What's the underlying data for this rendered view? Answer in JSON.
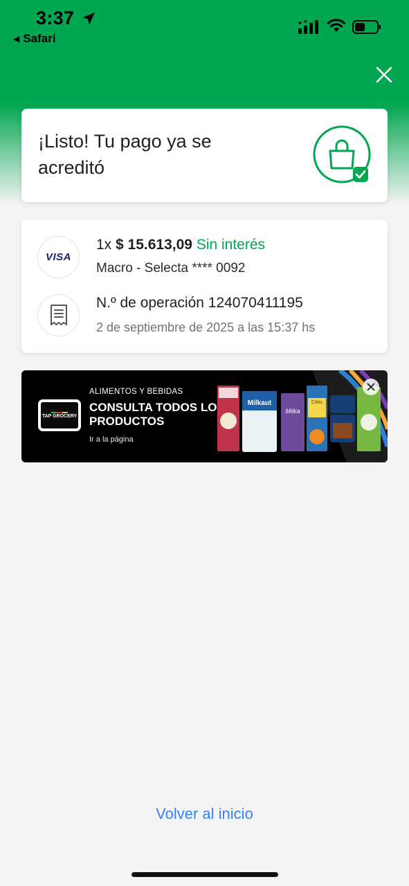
{
  "status_bar": {
    "time": "3:37",
    "back_app": "Safari",
    "icons": [
      "location-arrow-icon",
      "signal-icon",
      "wifi-icon",
      "battery-icon"
    ]
  },
  "header": {
    "close_icon": "close-icon",
    "accent_color": "#00a650"
  },
  "success_card": {
    "title": "¡Listo! Tu pago ya se acreditó",
    "badge_icon": "shopping-bag-check-icon"
  },
  "payment": {
    "installments": "1x",
    "amount": "$ 15.613,09",
    "interest": "Sin interés",
    "card_brand": "VISA",
    "card_description": "Macro - Selecta **** 0092",
    "operation_label": "N.º de operación 124070411195",
    "date": "2 de septiembre de 2025 a las 15:37 hs",
    "receipt_icon": "receipt-icon"
  },
  "banner": {
    "brand": "TAP GROCERY",
    "kicker": "ALIMENTOS Y BEBIDAS",
    "title": "CONSULTA TODOS LOS PRODUCTOS",
    "link": "Ir a la página",
    "products": [
      "Milkaut",
      "Milka",
      "Citric"
    ]
  },
  "footer": {
    "back_home": "Volver al inicio",
    "link_color": "#3483fa"
  }
}
